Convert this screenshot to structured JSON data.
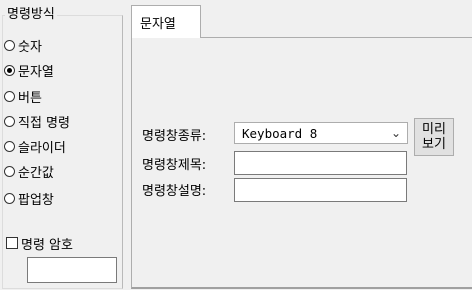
{
  "left_panel": {
    "title": "명령방식",
    "options": [
      {
        "label": "숫자",
        "selected": false
      },
      {
        "label": "문자열",
        "selected": true
      },
      {
        "label": "버튼",
        "selected": false
      },
      {
        "label": "직접 명령",
        "selected": false
      },
      {
        "label": "슬라이더",
        "selected": false
      },
      {
        "label": "순간값",
        "selected": false
      },
      {
        "label": "팝업창",
        "selected": false
      }
    ],
    "password_label": "명령 암호",
    "password_checked": false,
    "password_value": ""
  },
  "tab": {
    "label": "문자열"
  },
  "form": {
    "type_label": "명령창종류:",
    "type_value": "Keyboard 8",
    "title_label": "명령창제목:",
    "title_value": "",
    "desc_label": "명령창설명:",
    "desc_value": "",
    "preview_line1": "미리",
    "preview_line2": "보기"
  },
  "icons": {
    "dropdown": "chevron-down-icon"
  }
}
